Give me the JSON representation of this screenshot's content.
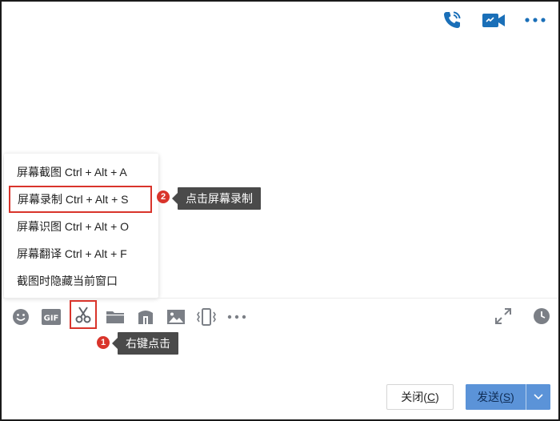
{
  "header": {
    "icons": [
      "phone-call-icon",
      "video-call-icon",
      "more-icon"
    ]
  },
  "context_menu": {
    "items": [
      {
        "label": "屏幕截图 Ctrl + Alt + A"
      },
      {
        "label": "屏幕录制 Ctrl + Alt + S"
      },
      {
        "label": "屏幕识图 Ctrl + Alt + O"
      },
      {
        "label": "屏幕翻译 Ctrl + Alt + F"
      },
      {
        "label": "截图时隐藏当前窗口"
      }
    ]
  },
  "annotations": {
    "step1": {
      "number": "1",
      "text": "右键点击"
    },
    "step2": {
      "number": "2",
      "text": "点击屏幕录制"
    }
  },
  "toolbar": {
    "left_icons": [
      "emoji-icon",
      "gif-icon",
      "scissors-icon",
      "folder-icon",
      "music-icon",
      "image-icon",
      "shake-icon",
      "more-icon"
    ],
    "right_icons": [
      "expand-icon",
      "history-clock-icon"
    ]
  },
  "footer": {
    "close_label": "关闭(",
    "close_key": "C",
    "close_suffix": ")",
    "send_label": "发送(",
    "send_key": "S",
    "send_suffix": ")"
  },
  "colors": {
    "accent_blue": "#1a6fb8",
    "highlight_red": "#d9342b",
    "send_button": "#5b93d8",
    "tooltip_bg": "#4a4a4a",
    "icon_gray": "#7b7f86"
  }
}
